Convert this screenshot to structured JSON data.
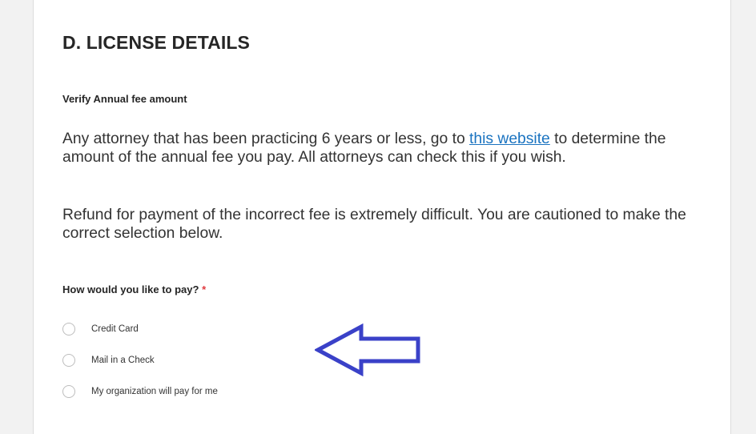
{
  "section": {
    "title": "D. LICENSE DETAILS",
    "subheading": "Verify Annual fee amount"
  },
  "paragraphs": {
    "p1_before_link": "Any attorney that has been practicing 6 years or less, go to ",
    "p1_link": "this website",
    "p1_after_link": " to determine the amount of the annual fee you pay.  All attorneys can check this if you wish.",
    "p2": "Refund for payment of the incorrect fee is extremely difficult. You are cautioned to make the correct selection below."
  },
  "question": {
    "label": "How would you like to pay?",
    "required_marker": "*",
    "options": [
      {
        "label": "Credit Card",
        "selected": false
      },
      {
        "label": "Mail in a Check",
        "selected": false
      },
      {
        "label": "My organization will pay for me",
        "selected": false
      }
    ]
  },
  "colors": {
    "link": "#1a73c0",
    "required": "#e0393e",
    "arrow": "#3a41c8"
  },
  "icons": {
    "annotation": "left-arrow-icon"
  }
}
